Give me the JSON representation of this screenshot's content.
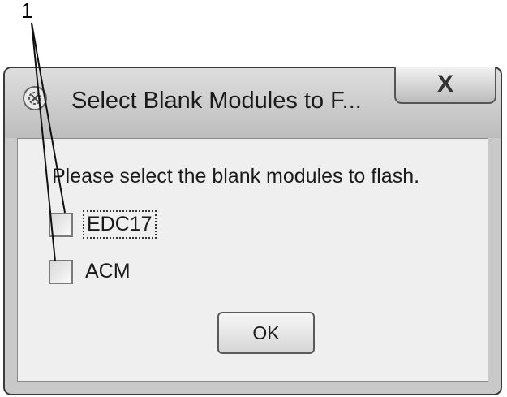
{
  "callout": {
    "label": "1"
  },
  "dialog": {
    "title": "Select Blank Modules to F...",
    "close_label": "X",
    "instruction": "Please select the blank modules to flash.",
    "options": [
      {
        "label": "EDC17",
        "checked": false,
        "focused": true
      },
      {
        "label": "ACM",
        "checked": false,
        "focused": false
      }
    ],
    "ok_label": "OK"
  }
}
